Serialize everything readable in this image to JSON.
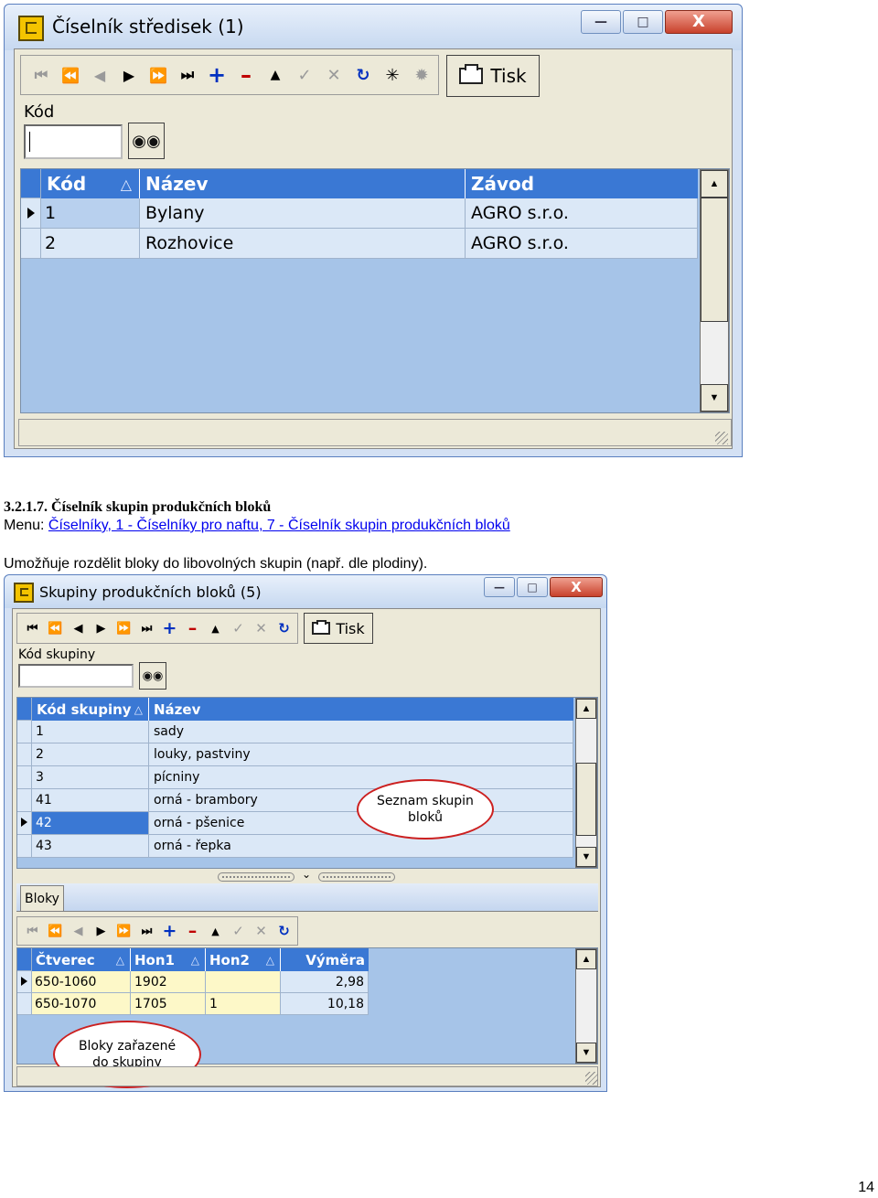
{
  "window1": {
    "title": "Číselník středisek (1)",
    "print_label": "Tisk",
    "code_label": "Kód",
    "columns": [
      "Kód",
      "Název",
      "Závod"
    ],
    "rows": [
      {
        "kod": "1",
        "nazev": "Bylany",
        "zavod": "AGRO s.r.o."
      },
      {
        "kod": "2",
        "nazev": "Rozhovice",
        "zavod": "AGRO s.r.o."
      }
    ]
  },
  "section": {
    "heading": "3.2.1.7. Číselník skupin produkčních bloků",
    "menu_prefix": "Menu: ",
    "menu_link": "Číselníky, 1 - Číselníky pro naftu, 7 - Číselník skupin produkčních bloků",
    "description": "Umožňuje rozdělit bloky do libovolných skupin (např. dle plodiny)."
  },
  "window2": {
    "title": "Skupiny produkčních bloků (5)",
    "print_label": "Tisk",
    "group_code_label": "Kód skupiny",
    "columns": [
      "Kód skupiny",
      "Název"
    ],
    "rows": [
      {
        "kod": "1",
        "nazev": "sady"
      },
      {
        "kod": "2",
        "nazev": "louky, pastviny"
      },
      {
        "kod": "3",
        "nazev": "pícniny"
      },
      {
        "kod": "41",
        "nazev": "orná - brambory"
      },
      {
        "kod": "42",
        "nazev": "orná - pšenice"
      },
      {
        "kod": "43",
        "nazev": "orná - řepka"
      }
    ],
    "callout_groups": "Seznam skupin bloků",
    "tab_label": "Bloky",
    "sub_columns": [
      "Čtverec",
      "Hon1",
      "Hon2",
      "Výměra"
    ],
    "sub_rows": [
      {
        "ctverec": "650-1060",
        "hon1": "1902",
        "hon2": "",
        "vymera": "2,98"
      },
      {
        "ctverec": "650-1070",
        "hon1": "1705",
        "hon2": "1",
        "vymera": "10,18"
      }
    ],
    "callout_blocks": "Bloky zařazené do skupiny"
  },
  "page_number": "14"
}
